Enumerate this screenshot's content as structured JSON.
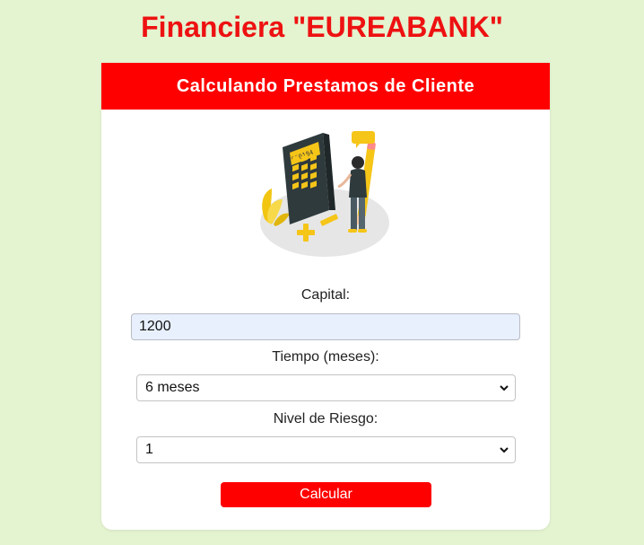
{
  "header": {
    "title": "Financiera \"EUREABANK\""
  },
  "card": {
    "title": "Calculando Prestamos de Cliente",
    "illustration": {
      "icon": "calculator-woman-illustration",
      "display_digits": "950184"
    },
    "capital": {
      "label": "Capital:",
      "value": "1200"
    },
    "tiempo": {
      "label": "Tiempo (meses):",
      "selected": "6 meses"
    },
    "riesgo": {
      "label": "Nivel de Riesgo:",
      "selected": "1"
    },
    "button_label": "Calcular"
  },
  "colors": {
    "background": "#e4f3d0",
    "brand_red": "#ff0000",
    "title_red": "#ee1111",
    "input_fill": "#e8f0fe"
  }
}
